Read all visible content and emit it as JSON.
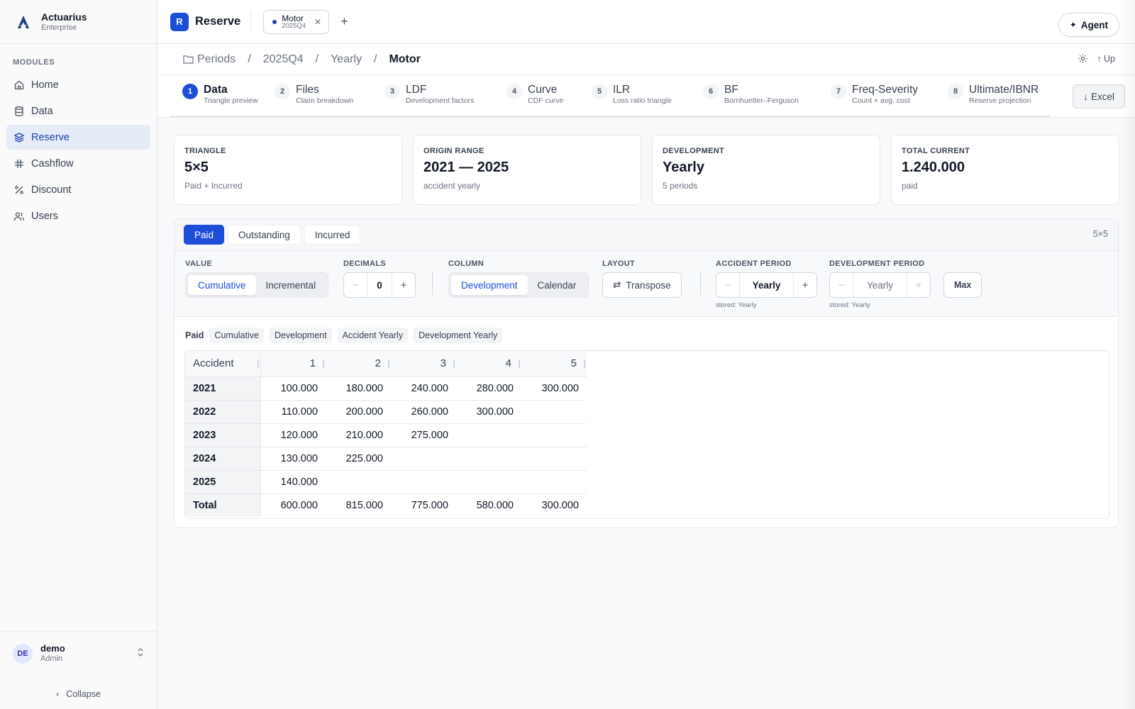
{
  "brand": {
    "name": "Actuarius",
    "sub": "Enterprise"
  },
  "sidebar": {
    "section": "MODULES",
    "items": [
      {
        "label": "Home",
        "icon": "home-icon"
      },
      {
        "label": "Data",
        "icon": "database-icon"
      },
      {
        "label": "Reserve",
        "icon": "layers-icon"
      },
      {
        "label": "Cashflow",
        "icon": "hash-icon"
      },
      {
        "label": "Discount",
        "icon": "percent-icon"
      },
      {
        "label": "Users",
        "icon": "users-icon"
      }
    ],
    "active": "Reserve"
  },
  "user": {
    "initials": "DE",
    "name": "demo",
    "role": "Admin",
    "collapse": "Collapse"
  },
  "header": {
    "badge": "R",
    "title": "Reserve",
    "tab": {
      "name": "Motor",
      "sub": "2025Q4"
    },
    "agent": "Agent"
  },
  "breadcrumb": {
    "items": [
      "Periods",
      "2025Q4",
      "Yearly"
    ],
    "current": "Motor",
    "up": "Up"
  },
  "steps": [
    {
      "num": "1",
      "title": "Data",
      "sub": "Triangle preview"
    },
    {
      "num": "2",
      "title": "Files",
      "sub": "Claim breakdown"
    },
    {
      "num": "3",
      "title": "LDF",
      "sub": "Development factors"
    },
    {
      "num": "4",
      "title": "Curve",
      "sub": "CDF curve"
    },
    {
      "num": "5",
      "title": "ILR",
      "sub": "Loss ratio triangle"
    },
    {
      "num": "6",
      "title": "BF",
      "sub": "Bornhuetter–Ferguson"
    },
    {
      "num": "7",
      "title": "Freq-Severity",
      "sub": "Count × avg. cost"
    },
    {
      "num": "8",
      "title": "Ultimate/IBNR",
      "sub": "Reserve projection"
    }
  ],
  "excel": "Excel",
  "cards": [
    {
      "label": "TRIANGLE",
      "value": "5×5",
      "sub": "Paid + Incurred"
    },
    {
      "label": "ORIGIN RANGE",
      "value": "2021 — 2025",
      "sub": "accident yearly"
    },
    {
      "label": "DEVELOPMENT",
      "value": "Yearly",
      "sub": "5 periods"
    },
    {
      "label": "TOTAL CURRENT",
      "value": "1.240.000",
      "sub": "paid"
    }
  ],
  "panel": {
    "pills": [
      "Paid",
      "Outstanding",
      "Incurred"
    ],
    "active_pill": "Paid",
    "dim": "5×5"
  },
  "controls": {
    "value": {
      "label": "VALUE",
      "options": [
        "Cumulative",
        "Incremental"
      ],
      "active": "Cumulative"
    },
    "decimals": {
      "label": "DECIMALS",
      "value": "0",
      "minus": "−",
      "plus": "+"
    },
    "column": {
      "label": "COLUMN",
      "options": [
        "Development",
        "Calendar"
      ],
      "active": "Development"
    },
    "layout": {
      "label": "LAYOUT",
      "button": "Transpose"
    },
    "accident_period": {
      "label": "ACCIDENT PERIOD",
      "value": "Yearly",
      "stored": "stored: Yearly"
    },
    "development_period": {
      "label": "DEVELOPMENT PERIOD",
      "value": "Yearly",
      "stored": "stored: Yearly",
      "max": "Max"
    }
  },
  "tags": [
    "Paid",
    "Cumulative",
    "Development",
    "Accident Yearly",
    "Development Yearly"
  ],
  "table": {
    "corner": "Accident",
    "columns": [
      "1",
      "2",
      "3",
      "4",
      "5"
    ],
    "rows": [
      {
        "label": "2021",
        "cells": [
          "100.000",
          "180.000",
          "240.000",
          "280.000",
          "300.000"
        ]
      },
      {
        "label": "2022",
        "cells": [
          "110.000",
          "200.000",
          "260.000",
          "300.000",
          ""
        ]
      },
      {
        "label": "2023",
        "cells": [
          "120.000",
          "210.000",
          "275.000",
          "",
          ""
        ]
      },
      {
        "label": "2024",
        "cells": [
          "130.000",
          "225.000",
          "",
          "",
          ""
        ]
      },
      {
        "label": "2025",
        "cells": [
          "140.000",
          "",
          "",
          "",
          ""
        ]
      },
      {
        "label": "Total",
        "cells": [
          "600.000",
          "815.000",
          "775.000",
          "580.000",
          "300.000"
        ]
      }
    ]
  }
}
